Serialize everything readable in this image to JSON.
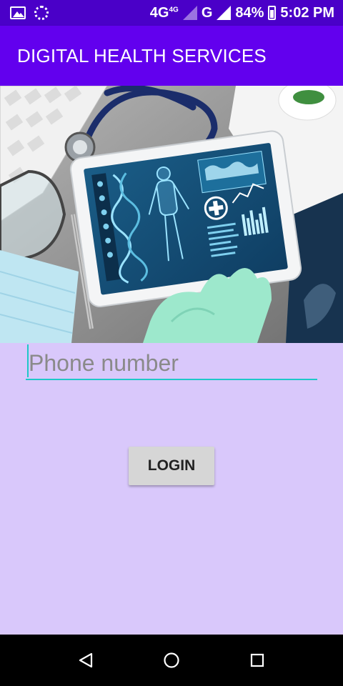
{
  "status_bar": {
    "network": "4G",
    "network_sup": "4G",
    "network2": "G",
    "battery": "84%",
    "time": "5:02 PM"
  },
  "app_bar": {
    "title": "DIGITAL HEALTH SERVICES"
  },
  "hero": {
    "image": "medical-tablet-stethoscope-photo"
  },
  "form": {
    "phone_placeholder": "Phone number",
    "phone_value": "",
    "login_label": "LOGIN"
  },
  "colors": {
    "status_bar": "#4a00c8",
    "app_bar": "#6200ee",
    "background": "#d9c8fb",
    "accent": "#1ec8c8",
    "button": "#d6d6d6"
  },
  "nav": {
    "icons": [
      "back-icon",
      "home-icon",
      "recents-icon"
    ]
  }
}
